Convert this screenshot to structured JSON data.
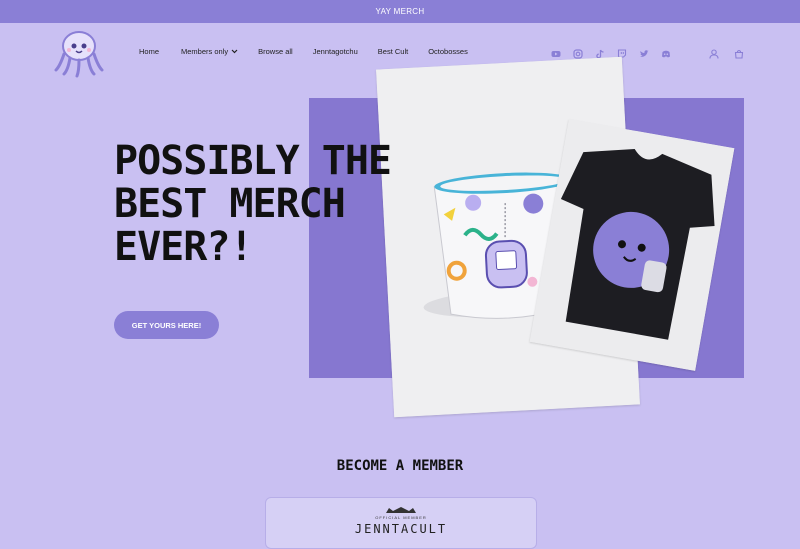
{
  "announcement": "YAY MERCH",
  "nav": {
    "items": [
      {
        "label": "Home"
      },
      {
        "label": "Members only"
      },
      {
        "label": "Browse all"
      },
      {
        "label": "Jenntagotchu"
      },
      {
        "label": "Best Cult"
      },
      {
        "label": "Octobosses"
      }
    ]
  },
  "social_icons": [
    "youtube-icon",
    "instagram-icon",
    "tiktok-icon",
    "twitch-icon",
    "twitter-icon",
    "discord-icon"
  ],
  "utility_icons": [
    "account-icon",
    "cart-icon"
  ],
  "hero": {
    "headline_line1": "POSSIBLY THE",
    "headline_line2": "BEST MERCH",
    "headline_line3": "EVER?!",
    "cta_label": "GET YOURS HERE!"
  },
  "members": {
    "title": "BECOME A MEMBER",
    "badge_small": "OFFICIAL MEMBER",
    "badge_big": "JENNTACULT"
  },
  "colors": {
    "page_bg": "#c9c0f2",
    "accent": "#8a7fd6",
    "hero_block": "#8677d0"
  }
}
